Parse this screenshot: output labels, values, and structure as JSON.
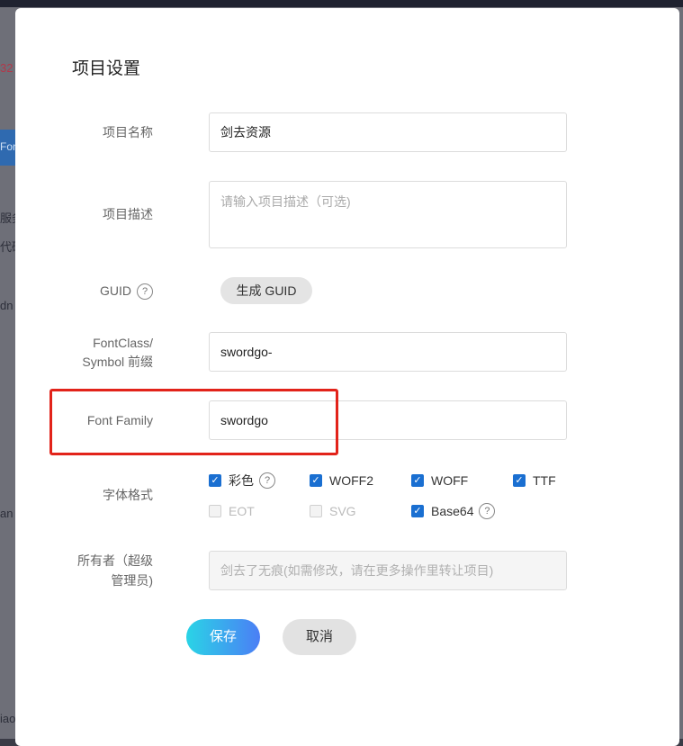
{
  "modal": {
    "title": "项目设置",
    "fields": {
      "project_name": {
        "label": "项目名称",
        "value": "剑去资源"
      },
      "project_desc": {
        "label": "项目描述",
        "placeholder": "请输入项目描述（可选)"
      },
      "guid": {
        "label": "GUID",
        "help": "?",
        "button": "生成 GUID"
      },
      "fontclass": {
        "label_line1": "FontClass/",
        "label_line2": "Symbol 前缀",
        "value": "swordgo-"
      },
      "font_family": {
        "label": "Font Family",
        "value": "swordgo"
      },
      "font_format": {
        "label": "字体格式",
        "options": [
          {
            "name": "彩色",
            "checked": true,
            "disabled": false,
            "help": "?"
          },
          {
            "name": "WOFF2",
            "checked": true,
            "disabled": false
          },
          {
            "name": "WOFF",
            "checked": true,
            "disabled": false
          },
          {
            "name": "TTF",
            "checked": true,
            "disabled": false
          },
          {
            "name": "EOT",
            "checked": false,
            "disabled": true
          },
          {
            "name": "SVG",
            "checked": false,
            "disabled": true
          },
          {
            "name": "Base64",
            "checked": true,
            "disabled": false,
            "help": "?"
          }
        ]
      },
      "owner": {
        "label_line1": "所有者（超级",
        "label_line2": "管理员)",
        "value": "剑去了无痕(如需修改，请在更多操作里转让项目)"
      }
    },
    "buttons": {
      "save": "保存",
      "cancel": "取消"
    }
  },
  "background": {
    "fragments": [
      "32",
      "Fon",
      "服务",
      "代码",
      "dn",
      "an",
      "iao"
    ]
  },
  "colors": {
    "accent": "#1a6fd1",
    "highlight_border": "#e2231a",
    "save_gradient_start": "#2ad4e6",
    "save_gradient_end": "#4b7ef5"
  }
}
